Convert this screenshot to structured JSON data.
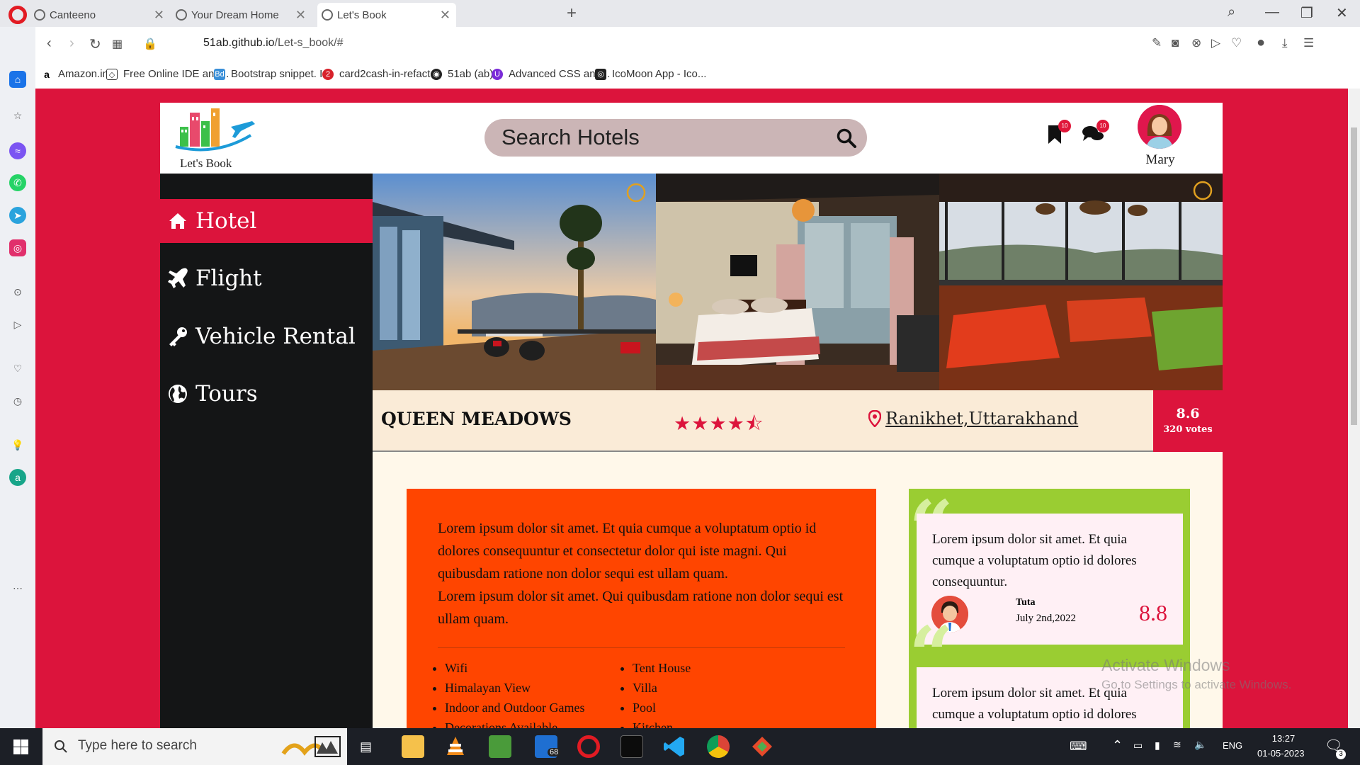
{
  "browser": {
    "tabs": [
      {
        "title": "Canteeno",
        "active": false
      },
      {
        "title": "Your Dream Home",
        "active": false
      },
      {
        "title": "Let's Book",
        "active": true
      }
    ],
    "url_host": "51ab.github.io",
    "url_path": "/Let-s_book/#",
    "bookmarks": [
      "Amazon.in",
      "Free Online IDE and...",
      "Bootstrap snippet. I...",
      "card2cash-in-refactor",
      "51ab (ab)",
      "Advanced CSS and...",
      "IcoMoon App - Ico..."
    ]
  },
  "site": {
    "logo_text": "Let's Book",
    "search_placeholder": "Search Hotels",
    "bookmark_badge": "10",
    "chat_badge": "10",
    "user_name": "Mary",
    "nav": [
      {
        "label": "Hotel",
        "icon": "home-icon",
        "active": true
      },
      {
        "label": "Flight",
        "icon": "plane-icon",
        "active": false
      },
      {
        "label": "Vehicle Rental",
        "icon": "key-icon",
        "active": false
      },
      {
        "label": "Tours",
        "icon": "globe-icon",
        "active": false
      }
    ],
    "hotel": {
      "name": "QUEEN MEADOWS",
      "rating": 4.5,
      "stars_text": "★★★★⯪",
      "location": "Ranikhet,Uttarakhand",
      "score": "8.6",
      "votes": "320 votes"
    },
    "description": {
      "para1": "Lorem ipsum dolor sit amet. Et quia cumque a voluptatum optio id dolores consequuntur et consectetur dolor qui iste magni. Qui quibusdam ratione non dolor sequi est ullam quam.",
      "para2": "Lorem ipsum dolor sit amet. Qui quibusdam ratione non dolor sequi est ullam quam.",
      "amenities_left": [
        "Wifi",
        "Himalayan View",
        "Indoor and Outdoor Games",
        "Decorations Available"
      ],
      "amenities_right": [
        "Tent House",
        "Villa",
        "Pool",
        "Kitchen"
      ]
    },
    "reviews": [
      {
        "text": "Lorem ipsum dolor sit amet. Et quia cumque a voluptatum optio id dolores consequuntur.",
        "name": "Tuta",
        "date": "July 2nd,2022",
        "score": "8.8"
      },
      {
        "text": "Lorem ipsum dolor sit amet. Et quia cumque a voluptatum optio id dolores"
      }
    ]
  },
  "watermark": {
    "title": "Activate Windows",
    "sub": "Go to Settings to activate Windows."
  },
  "taskbar": {
    "search_placeholder": "Type here to search",
    "mail_badge": "68",
    "lang": "ENG",
    "time": "13:27",
    "date": "01-05-2023",
    "notif_count": "3"
  },
  "colors": {
    "brand": "#dc143c",
    "desc_bg": "#ff4500",
    "review_bg": "#9acd32",
    "sidebar_bg": "#141516",
    "title_bg": "#faebd7"
  }
}
